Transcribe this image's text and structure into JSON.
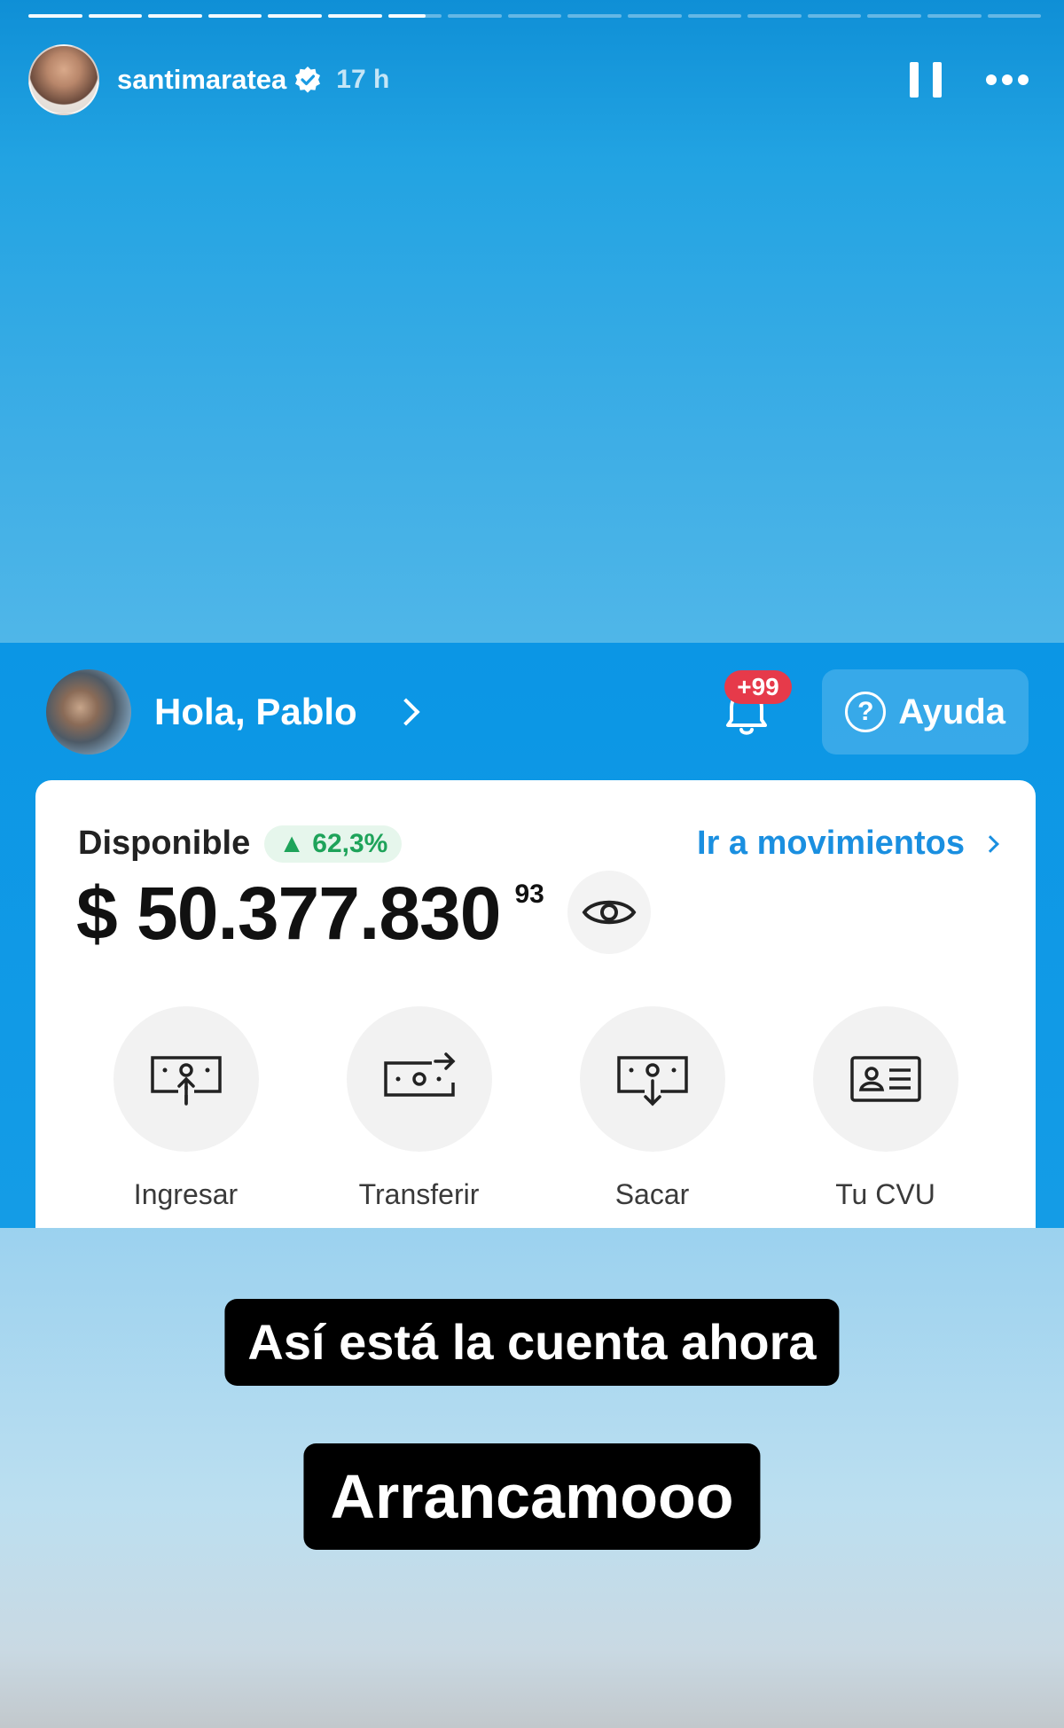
{
  "story": {
    "username": "santimaratea",
    "time_ago": "17 h",
    "progress": {
      "segments": 17,
      "completed": 6,
      "current_fraction": 0.7
    },
    "colors": {
      "sky_top": "#0f8fd6",
      "sky_bottom": "#c2c8cc",
      "sticker_bg": "#000000"
    }
  },
  "icons": {
    "verified": "verified-badge-icon",
    "pause": "pause-icon",
    "more": "more-options-icon"
  },
  "app": {
    "greeting": "Hola, Pablo",
    "notifications_badge": "+99",
    "help_label": "Ayuda",
    "card": {
      "available_label": "Disponible",
      "change_pct": "▲ 62,3%",
      "movements_link": "Ir a movimientos",
      "balance": "$ 50.377.830",
      "balance_cents": "93"
    },
    "actions": [
      {
        "label": "Ingresar",
        "icon": "deposit-icon"
      },
      {
        "label": "Transferir",
        "icon": "transfer-icon"
      },
      {
        "label": "Sacar",
        "icon": "withdraw-icon"
      },
      {
        "label": "Tu CVU",
        "icon": "id-card-icon"
      }
    ],
    "colors": {
      "app_blue": "#0b96e5",
      "link_blue": "#1a8fe0",
      "positive_green": "#1ea35a",
      "badge_red": "#e63a4a"
    }
  },
  "stickers": {
    "line1": "Así está la cuenta ahora",
    "line2": "Arrancamooo"
  }
}
